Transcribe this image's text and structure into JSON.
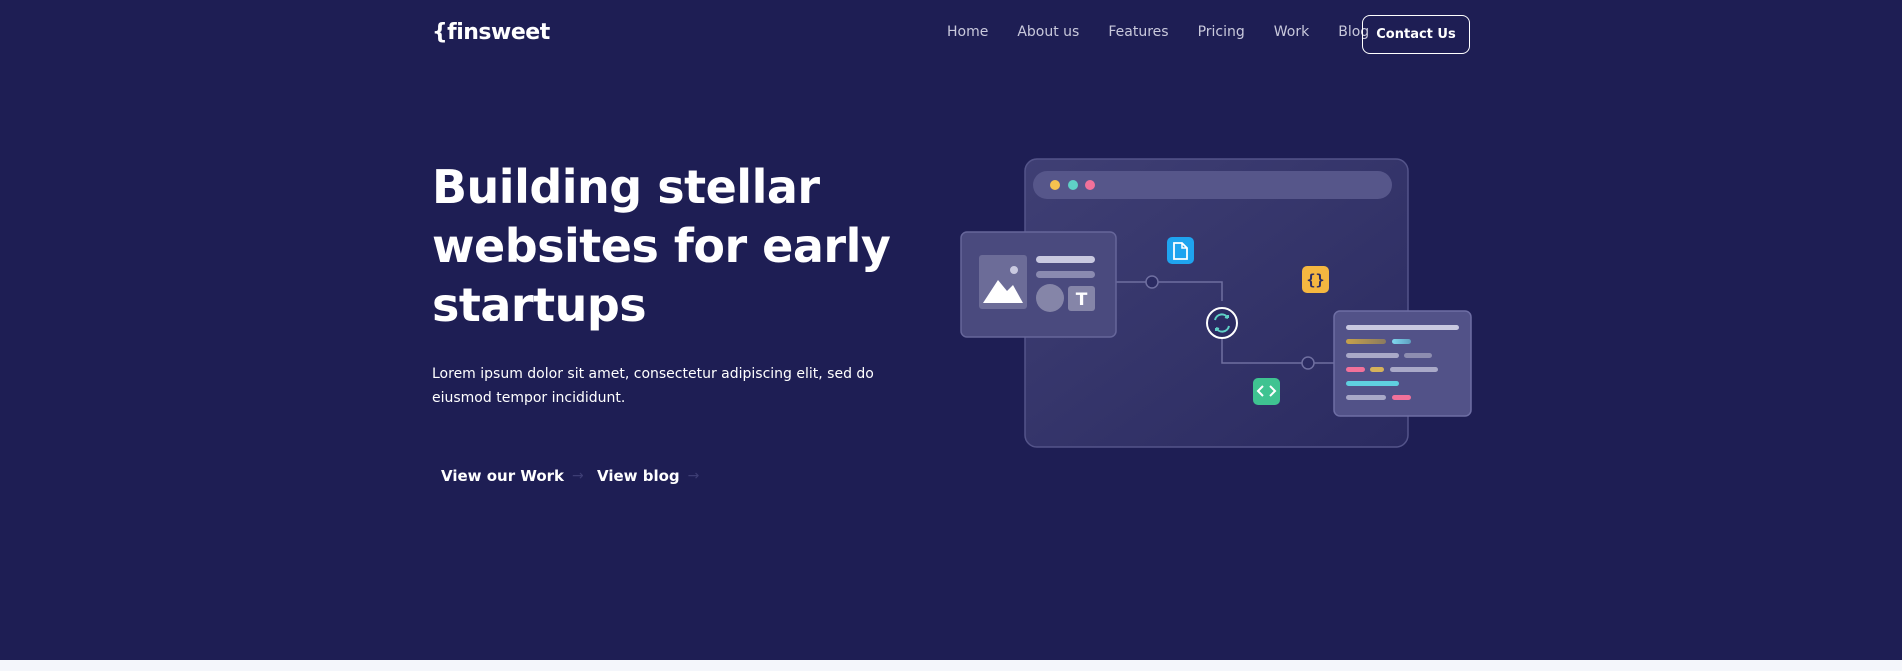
{
  "header": {
    "logo": "{finsweet",
    "nav": [
      "Home",
      "About us",
      "Features",
      "Pricing",
      "Work",
      "Blog"
    ],
    "contact_label": "Contact Us"
  },
  "hero": {
    "title": "Building stellar websites for early startups",
    "description": "Lorem ipsum dolor sit amet, consectetur adipiscing elit, sed do eiusmod tempor incididunt.",
    "cta_work": "View our Work",
    "cta_blog": "View blog",
    "arrow": "→"
  },
  "illustration": {
    "window_dots": [
      "#f7c24f",
      "#5fd0c6",
      "#f2719a"
    ],
    "icons": [
      "file-icon",
      "braces-icon",
      "sync-icon",
      "code-icon",
      "image-icon",
      "text-icon"
    ],
    "braces_glyph": "{}",
    "text_glyph": "T"
  },
  "colors": {
    "background": "#1e1e54",
    "accent_blue": "#1fa4ef",
    "accent_yellow": "#f5b740",
    "accent_green": "#3fc391"
  }
}
